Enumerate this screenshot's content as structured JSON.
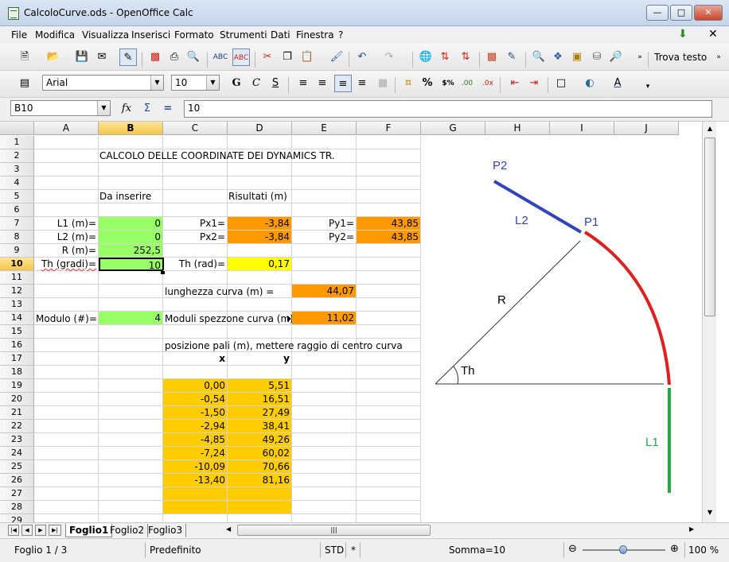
{
  "window": {
    "title": "CalcoloCurve.ods - OpenOffice Calc"
  },
  "menu": [
    "File",
    "Modifica",
    "Visualizza",
    "Inserisci",
    "Formato",
    "Strumenti",
    "Dati",
    "Finestra",
    "?"
  ],
  "toolbar": {
    "find_text_label": "Trova testo",
    "font_name": "Arial",
    "font_size": "10"
  },
  "formula_bar": {
    "name_box": "B10",
    "content": "10"
  },
  "columns": [
    "A",
    "B",
    "C",
    "D",
    "E",
    "F",
    "G",
    "H",
    "I",
    "J"
  ],
  "rows": [
    "1",
    "2",
    "3",
    "4",
    "5",
    "6",
    "7",
    "8",
    "9",
    "10",
    "11",
    "12",
    "13",
    "14",
    "15",
    "16",
    "17",
    "18",
    "19",
    "20",
    "21",
    "22",
    "23",
    "24",
    "25",
    "26",
    "27",
    "28",
    "29"
  ],
  "cells": {
    "title": "CALCOLO DELLE COORDINATE DEI DYNAMICS TR.",
    "inputs_header": "Da inserire",
    "results_header": "Risultati (m)",
    "l1_label": "L1 (m)=",
    "l1_value": "0",
    "l2_label": "L2 (m)=",
    "l2_value": "0",
    "r_label": "R (m)=",
    "r_value": "252,5",
    "th_label": "Th (gradi)=",
    "th_value": "10",
    "px1_label": "Px1=",
    "px1_value": "-3,84",
    "px2_label": "Px2=",
    "px2_value": "-3,84",
    "py1_label": "Py1=",
    "py1_value": "43,85",
    "py2_label": "Py2=",
    "py2_value": "43,85",
    "th_rad_label": "Th (rad)=",
    "th_rad_value": "0,17",
    "curve_length_label": "lunghezza curva (m) =",
    "curve_length_value": "44,07",
    "module_label": "Modulo (#)=",
    "module_value": "4",
    "module_segment_label": "Moduli spezzone curva (m)",
    "module_segment_value": "11,02",
    "poles_note": "posizione pali (m), mettere raggio di centro curva",
    "x_header": "x",
    "y_header": "y",
    "poles": [
      {
        "x": "0,00",
        "y": "5,51"
      },
      {
        "x": "-0,54",
        "y": "16,51"
      },
      {
        "x": "-1,50",
        "y": "27,49"
      },
      {
        "x": "-2,94",
        "y": "38,41"
      },
      {
        "x": "-4,85",
        "y": "49,26"
      },
      {
        "x": "-7,24",
        "y": "60,02"
      },
      {
        "x": "-10,09",
        "y": "70,66"
      },
      {
        "x": "-13,40",
        "y": "81,16"
      }
    ]
  },
  "diagram": {
    "p2": "P2",
    "p1": "P1",
    "l2": "L2",
    "r": "R",
    "th": "Th",
    "l1": "L1"
  },
  "sheet_tabs": [
    "Foglio1",
    "Foglio2",
    "Foglio3"
  ],
  "status": {
    "page": "Foglio 1 / 3",
    "style": "Predefinito",
    "mode": "STD",
    "modified": "*",
    "sum": "Somma=10",
    "zoom": "100 %"
  },
  "colors": {
    "green": "#99ff66",
    "orange": "#ff9900",
    "yellow": "#ffff00",
    "gold": "#ffcc00"
  }
}
